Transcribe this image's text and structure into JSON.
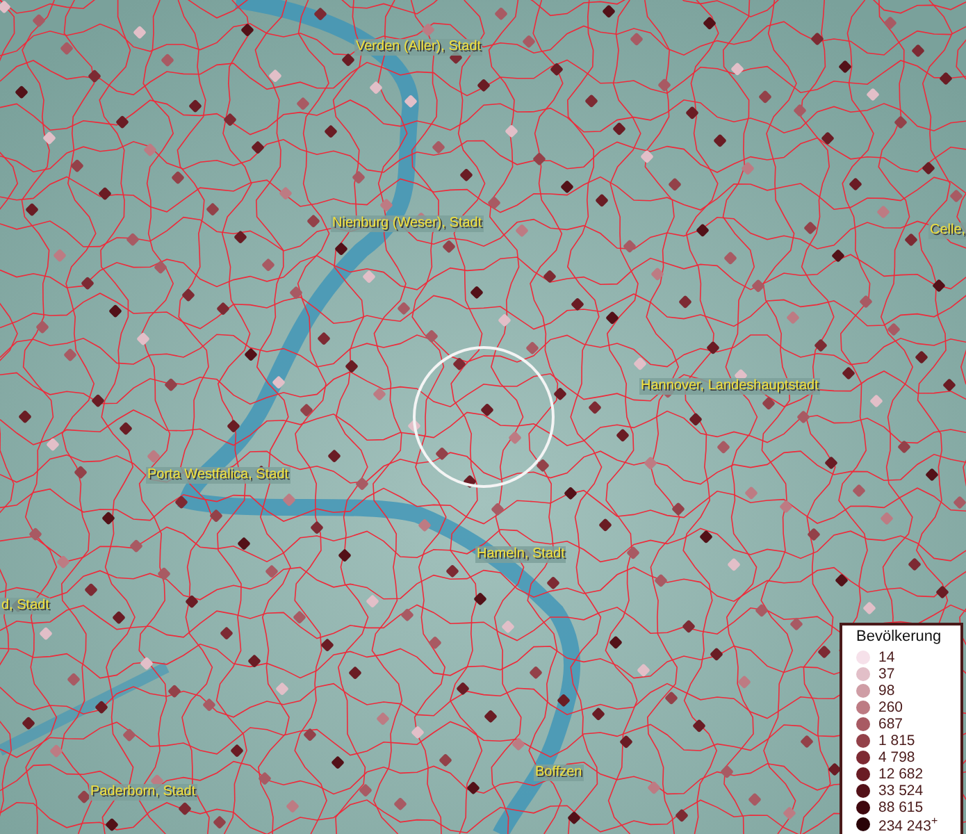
{
  "map": {
    "place_labels": [
      {
        "text": "Verden (Aller), Stadt"
      },
      {
        "text": "Nienburg (Weser), Stadt"
      },
      {
        "text": "Celle,"
      },
      {
        "text": "Hannover, Landeshauptstadt"
      },
      {
        "text": "Porta Westfalica, Stadt"
      },
      {
        "text": "d, Stadt"
      },
      {
        "text": "Hameln, Stadt"
      },
      {
        "text": "Paderborn, Stadt"
      },
      {
        "text": "Boffzen"
      }
    ]
  },
  "legend": {
    "title": "Bevölkerung",
    "items": [
      {
        "label": "14",
        "color": "#f6e1ea"
      },
      {
        "label": "37",
        "color": "#e2bfc8"
      },
      {
        "label": "98",
        "color": "#cf9da5"
      },
      {
        "label": "260",
        "color": "#bd7b83"
      },
      {
        "label": "687",
        "color": "#a85a63"
      },
      {
        "label": "1 815",
        "color": "#934149"
      },
      {
        "label": "4 798",
        "color": "#7d2a33"
      },
      {
        "label": "12 682",
        "color": "#6a1c24"
      },
      {
        "label": "33 524",
        "color": "#531118"
      },
      {
        "label": "88 615",
        "color": "#3f080e"
      },
      {
        "label": "234 243$^{+}$",
        "color": "#2a0307"
      }
    ]
  }
}
